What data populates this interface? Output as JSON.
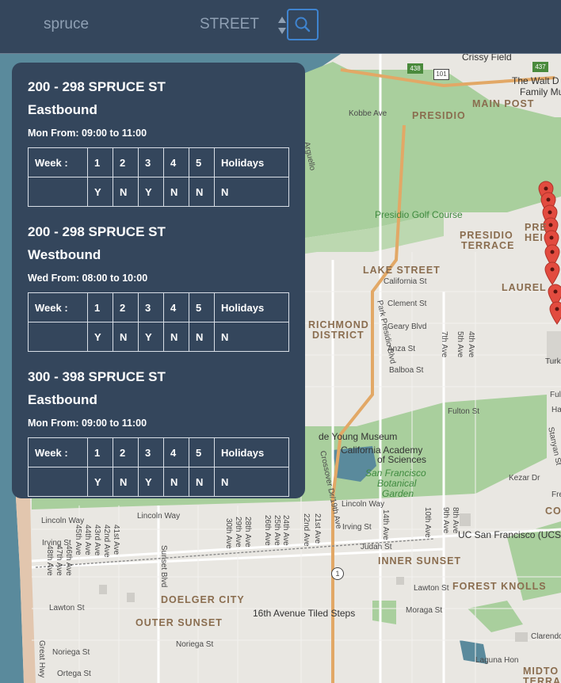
{
  "search": {
    "value": "spruce",
    "placeholder": "spruce"
  },
  "type_select": {
    "label": "STREET",
    "icon": "sort-arrows-icon"
  },
  "search_button": {
    "icon": "magnifier-icon"
  },
  "panel": {
    "columns": [
      "Week :",
      "1",
      "2",
      "3",
      "4",
      "5",
      "Holidays"
    ],
    "entries": [
      {
        "title": "200 - 298 SPRUCE ST",
        "direction": "Eastbound",
        "time": "Mon From: 09:00 to 11:00",
        "flags": [
          "Y",
          "N",
          "Y",
          "N",
          "N",
          "N"
        ]
      },
      {
        "title": "200 - 298 SPRUCE ST",
        "direction": "Westbound",
        "time": "Wed From: 08:00 to 10:00",
        "flags": [
          "Y",
          "N",
          "Y",
          "N",
          "N",
          "N"
        ]
      },
      {
        "title": "300 - 398 SPRUCE ST",
        "direction": "Eastbound",
        "time": "Mon From: 09:00 to 11:00",
        "flags": [
          "Y",
          "N",
          "Y",
          "N",
          "N",
          "N"
        ]
      }
    ]
  },
  "map": {
    "labels": {
      "crissy_field": "Crissy Field",
      "walt_disney": "The Walt D",
      "family_mus": "Family Mus",
      "main_post": "MAIN POST",
      "presidio": "PRESIDIO",
      "presidio_golf": "Presidio Golf Course",
      "presidio_terrace_1": "PRESIDIO",
      "presidio_terrace_2": "TERRACE",
      "pres_heights_1": "PRE",
      "pres_heights_2": "HEI",
      "lake_street": "LAKE STREET",
      "california_st": "California St",
      "clement_st": "Clement St",
      "laurel": "LAUREL",
      "richmond_1": "RICHMOND",
      "richmond_2": "DISTRICT",
      "geary": "Geary Blvd",
      "anza": "Anza St",
      "balboa": "Balboa St",
      "fulton": "Fulton St",
      "park_presidio": "Park Presidio Blvd",
      "de_young": "de Young Museum",
      "cal_academy_1": "California Academy",
      "cal_academy_2": "of Sciences",
      "botanical_1": "San Francisco",
      "botanical_2": "Botanical",
      "botanical_3": "Garden",
      "crossover": "Crossover Dr/19th Ave",
      "lincoln_way_1": "Lincoln Way",
      "lincoln_way_2": "Lincoln Way",
      "lincoln_way_3": "Lincoln Way",
      "irving_st_1": "Irving St",
      "irving_st_2": "Irving St",
      "judah_st": "Judah St",
      "ucsf": "UC San Francisco (UCS",
      "inner_sunset": "INNER SUNSET",
      "forest_knolls": "FOREST KNOLLS",
      "lawton_st_1": "Lawton St",
      "lawton_st_2": "Lawton St",
      "doelger_city": "DOELGER CITY",
      "outer_sunset": "OUTER SUNSET",
      "tiled_steps": "16th Avenue Tiled Steps",
      "moraga_st": "Moraga St",
      "noriega_1": "Noriega St",
      "noriega_2": "Noriega St",
      "ortega": "Ortega St",
      "sunset_blvd": "Sunset Blvd",
      "stanyan": "Stanyan St",
      "kezar": "Kezar Dr",
      "clarendon": "Clarendon Av",
      "laguna_honda": "Laguna Hon",
      "great_hwy": "Great Hwy",
      "kobbe": "Kobbe Ave",
      "arguello": "Arguello",
      "co_cut": "CO",
      "midtown_1": "MIDTO",
      "midtown_2": "TERRA",
      "turk": "Turk",
      "fulton_cut": "Ful",
      "hayes_cut": "Ha",
      "fre_cut": "Fre",
      "hwy_1": "1",
      "hwy_101": "101",
      "hwy_437": "437",
      "hwy_438": "438",
      "av_4th": "4th Ave",
      "av_5th": "5th Ave",
      "av_7th": "7th Ave",
      "av_8th": "8th Ave",
      "av_9th": "9th Ave",
      "av_10th": "10th Ave",
      "av_14th": "14th Ave",
      "av_21st": "21st Ave",
      "av_22nd": "22nd Ave",
      "av_24th": "24th Ave",
      "av_25th": "25th Ave",
      "av_26th": "26th Ave",
      "av_28th": "28th Ave",
      "av_29th": "29th Ave",
      "av_30th": "30th Ave",
      "av_41st": "41st Ave",
      "av_42nd": "42nd Ave",
      "av_43rd": "43rd Ave",
      "av_44th": "44th Ave",
      "av_45th": "45th Ave",
      "av_46th": "46th Ave",
      "av_47th": "47th Ave",
      "av_48th": "48th Ave"
    },
    "colors": {
      "water": "#5a8a9c",
      "park": "#a9cf9d",
      "land": "#e9e7e2",
      "beach": "#e2c6ae",
      "marker": "#e24b3f"
    }
  },
  "colors": {
    "bar": "#34465c",
    "accent": "#3f84d0",
    "text_muted": "#8fa0b4"
  }
}
